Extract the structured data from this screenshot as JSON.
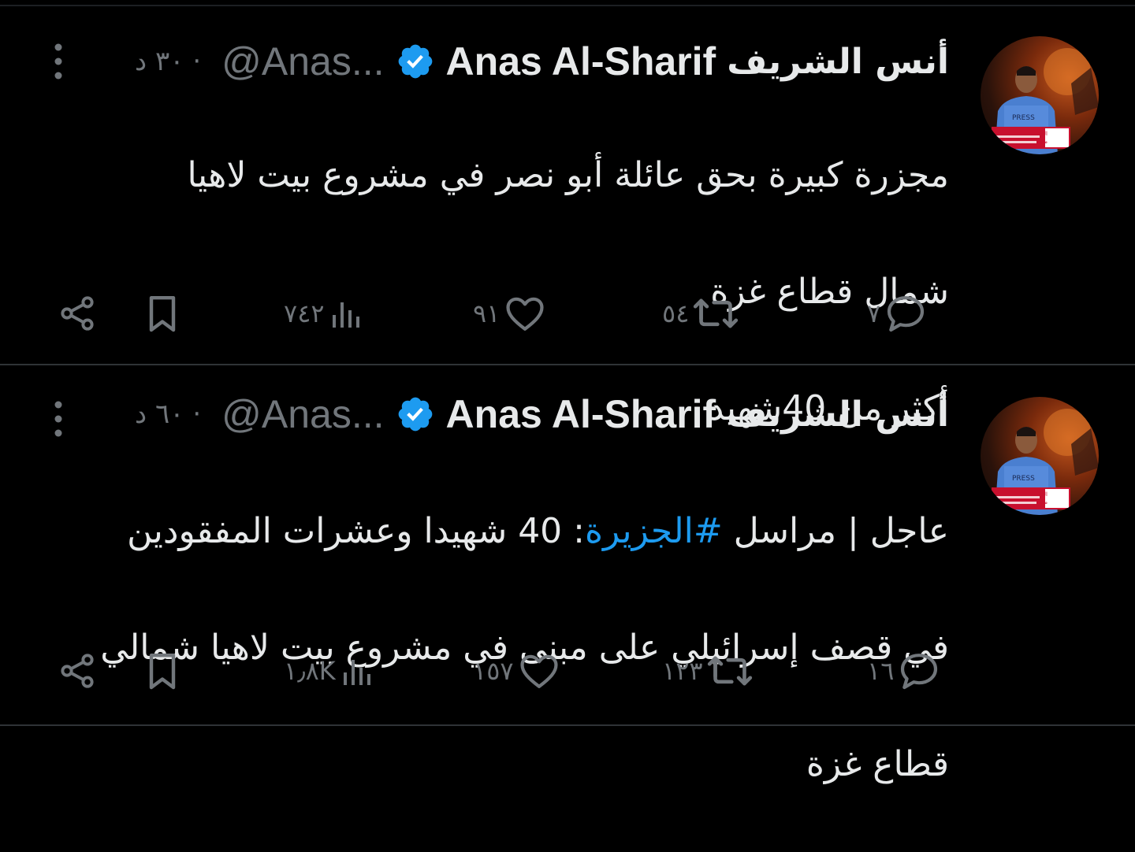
{
  "tweets": [
    {
      "author_name_ar": "أنس الشريف",
      "author_name_en": "Anas Al-Sharif",
      "handle": "@Anas...",
      "time": "· ٣٠ د",
      "text_lines": [
        "مجزرة كبيرة بحق عائلة أبو نصر في مشروع بيت لاهيا",
        "شمال قطاع غزة",
        "أكثر من 40شهيد"
      ],
      "stats": {
        "replies": "٧",
        "retweets": "٥٤",
        "likes": "٩١",
        "views": "٧٤٢"
      }
    },
    {
      "author_name_ar": "أنس الشريف",
      "author_name_en": "Anas Al-Sharif",
      "handle": "@Anas...",
      "time": "· ٦٠ د",
      "text_prefix": "عاجل | مراسل ",
      "hashtag": "#الجزيرة",
      "text_suffix": ": 40 شهيدا وعشرات المفقودين",
      "text_lines": [
        "في قصف إسرائيلي على مبنى في مشروع بيت لاهيا شمالي",
        "قطاع غزة"
      ],
      "stats": {
        "replies": "١٦",
        "retweets": "١٢٣",
        "likes": "١٥٧",
        "views": "١٫٨K"
      }
    }
  ],
  "avatar_badge_text": [
    "التغطية",
    "متواصلة"
  ],
  "colors": {
    "background": "#000000",
    "text": "#e7e9ea",
    "muted": "#71767b",
    "accent": "#1d9bf0",
    "divider": "#2f3336"
  },
  "icons": [
    "more-icon",
    "verified-icon",
    "reply-icon",
    "retweet-icon",
    "like-icon",
    "views-icon",
    "bookmark-icon",
    "share-icon"
  ]
}
